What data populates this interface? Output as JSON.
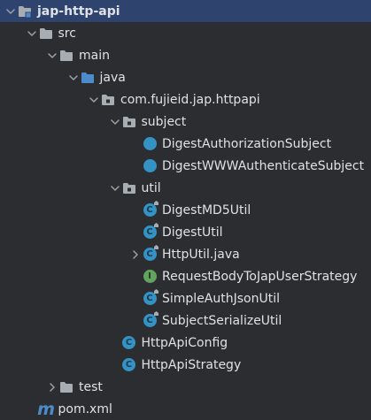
{
  "colors": {
    "background": "#2b2d30",
    "selection": "#2e436e",
    "folder": "#a8adb3",
    "source_folder": "#4d8ccb",
    "class_badge": "#3592c4",
    "interface_badge": "#62a35f",
    "maven": "#4d8ccb",
    "text": "#dfe1e5"
  },
  "tree": [
    {
      "label": "jap-http-api",
      "depth": 0,
      "expanded": true,
      "icon": "module-folder-icon",
      "bold": true,
      "selected": true
    },
    {
      "label": "src",
      "depth": 1,
      "expanded": true,
      "icon": "folder-icon"
    },
    {
      "label": "main",
      "depth": 2,
      "expanded": true,
      "icon": "folder-icon"
    },
    {
      "label": "java",
      "depth": 3,
      "expanded": true,
      "icon": "source-folder-icon"
    },
    {
      "label": "com.fujieid.jap.httpapi",
      "depth": 4,
      "expanded": true,
      "icon": "package-icon"
    },
    {
      "label": "subject",
      "depth": 5,
      "expanded": true,
      "icon": "package-icon"
    },
    {
      "label": "DigestAuthorizationSubject",
      "depth": 6,
      "icon": "class-icon"
    },
    {
      "label": "DigestWWWAuthenticateSubject",
      "depth": 6,
      "icon": "class-icon"
    },
    {
      "label": "util",
      "depth": 5,
      "expanded": true,
      "icon": "package-icon"
    },
    {
      "label": "DigestMD5Util",
      "depth": 6,
      "icon": "class-icon",
      "badge": "C"
    },
    {
      "label": "DigestUtil",
      "depth": 6,
      "icon": "class-icon",
      "badge": "C"
    },
    {
      "label": "HttpUtil.java",
      "depth": 6,
      "expanded": false,
      "icon": "class-icon",
      "badge": "C"
    },
    {
      "label": "RequestBodyToJapUserStrategy",
      "depth": 6,
      "icon": "interface-icon",
      "badge": "I"
    },
    {
      "label": "SimpleAuthJsonUtil",
      "depth": 6,
      "icon": "class-icon",
      "badge": "C"
    },
    {
      "label": "SubjectSerializeUtil",
      "depth": 6,
      "icon": "class-icon",
      "badge": "C"
    },
    {
      "label": "HttpApiConfig",
      "depth": 5,
      "icon": "class-icon",
      "badge": "C"
    },
    {
      "label": "HttpApiStrategy",
      "depth": 5,
      "icon": "class-icon",
      "badge": "C"
    },
    {
      "label": "test",
      "depth": 2,
      "expanded": false,
      "icon": "folder-icon"
    },
    {
      "label": "pom.xml",
      "depth": 1,
      "icon": "maven-icon",
      "badge": "m"
    }
  ]
}
